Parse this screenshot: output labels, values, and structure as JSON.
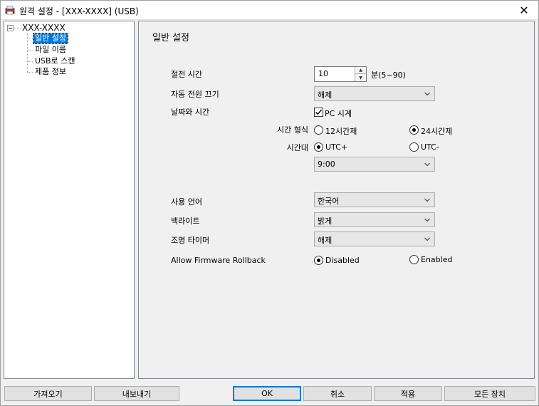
{
  "window": {
    "title": "원격 설정 - [XXX-XXXX] (USB)",
    "close_glyph": "✕"
  },
  "tree": {
    "root": "XXX-XXXX",
    "items": [
      {
        "label": "일반 설정",
        "selected": true
      },
      {
        "label": "파일 이름",
        "selected": false
      },
      {
        "label": "USB로 스캔",
        "selected": false
      },
      {
        "label": "제품 정보",
        "selected": false
      }
    ]
  },
  "panel": {
    "title": "일반 설정",
    "sleep_time": {
      "label": "절전 시간",
      "value": "10",
      "unit": "분(5~90)"
    },
    "auto_power_off": {
      "label": "자동 전원 끄기",
      "value": "해제"
    },
    "date_time": {
      "label": "날짜와 시간",
      "pc_clock_label": "PC 시계",
      "pc_clock_checked": true,
      "time_format_label": "시간 형식",
      "format_12": "12시간제",
      "format_24": "24시간제",
      "format_selected": "24",
      "timezone_label": "시간대",
      "utc_plus": "UTC+",
      "utc_minus": "UTC-",
      "utc_selected": "plus",
      "offset_value": "9:00"
    },
    "language": {
      "label": "사용 언어",
      "value": "한국어"
    },
    "backlight": {
      "label": "백라이트",
      "value": "밝게"
    },
    "light_timer": {
      "label": "조명 타이머",
      "value": "해제"
    },
    "firmware_rollback": {
      "label": "Allow Firmware Rollback",
      "disabled_label": "Disabled",
      "enabled_label": "Enabled",
      "selected": "disabled"
    }
  },
  "buttons": {
    "import": "가져오기",
    "export": "내보내기",
    "ok": "OK",
    "cancel": "취소",
    "apply": "적용",
    "all_devices": "모든 장치"
  }
}
